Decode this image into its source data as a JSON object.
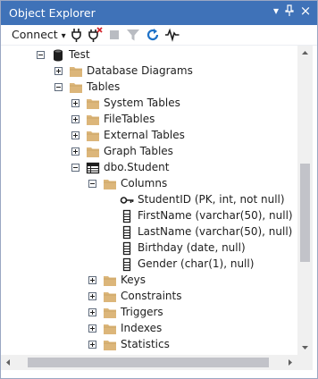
{
  "window": {
    "title": "Object Explorer",
    "controls": [
      "▾",
      "⊥",
      "×"
    ]
  },
  "toolbar": {
    "connect_label": "Connect",
    "connect_arrow": "▾",
    "buttons": [
      "connect-object-icon",
      "disconnect-icon",
      "stop-icon",
      "filter-icon",
      "refresh-icon",
      "activity-monitor-icon"
    ]
  },
  "tree": {
    "items": [
      {
        "label": "Test",
        "expander": "minus",
        "icon": "database"
      },
      {
        "label": "Database Diagrams",
        "expander": "plus",
        "icon": "folder"
      },
      {
        "label": "Tables",
        "expander": "minus",
        "icon": "folder"
      },
      {
        "label": "System Tables",
        "expander": "plus",
        "icon": "folder"
      },
      {
        "label": "FileTables",
        "expander": "plus",
        "icon": "folder"
      },
      {
        "label": "External Tables",
        "expander": "plus",
        "icon": "folder"
      },
      {
        "label": "Graph Tables",
        "expander": "plus",
        "icon": "folder"
      },
      {
        "label": "dbo.Student",
        "expander": "minus",
        "icon": "table"
      },
      {
        "label": "Columns",
        "expander": "minus",
        "icon": "folder"
      },
      {
        "label": "StudentID (PK, int, not null)",
        "expander": "none",
        "icon": "key"
      },
      {
        "label": "FirstName (varchar(50), null)",
        "expander": "none",
        "icon": "column"
      },
      {
        "label": "LastName (varchar(50), null)",
        "expander": "none",
        "icon": "column"
      },
      {
        "label": "Birthday (date, null)",
        "expander": "none",
        "icon": "column"
      },
      {
        "label": "Gender (char(1), null)",
        "expander": "none",
        "icon": "column"
      },
      {
        "label": "Keys",
        "expander": "plus",
        "icon": "folder"
      },
      {
        "label": "Constraints",
        "expander": "plus",
        "icon": "folder"
      },
      {
        "label": "Triggers",
        "expander": "plus",
        "icon": "folder"
      },
      {
        "label": "Indexes",
        "expander": "plus",
        "icon": "folder"
      },
      {
        "label": "Statistics",
        "expander": "plus",
        "icon": "folder"
      }
    ]
  },
  "colors": {
    "titlebar": "#3f72b8",
    "folder": "#dcb67a",
    "refresh": "#1e72c8"
  }
}
